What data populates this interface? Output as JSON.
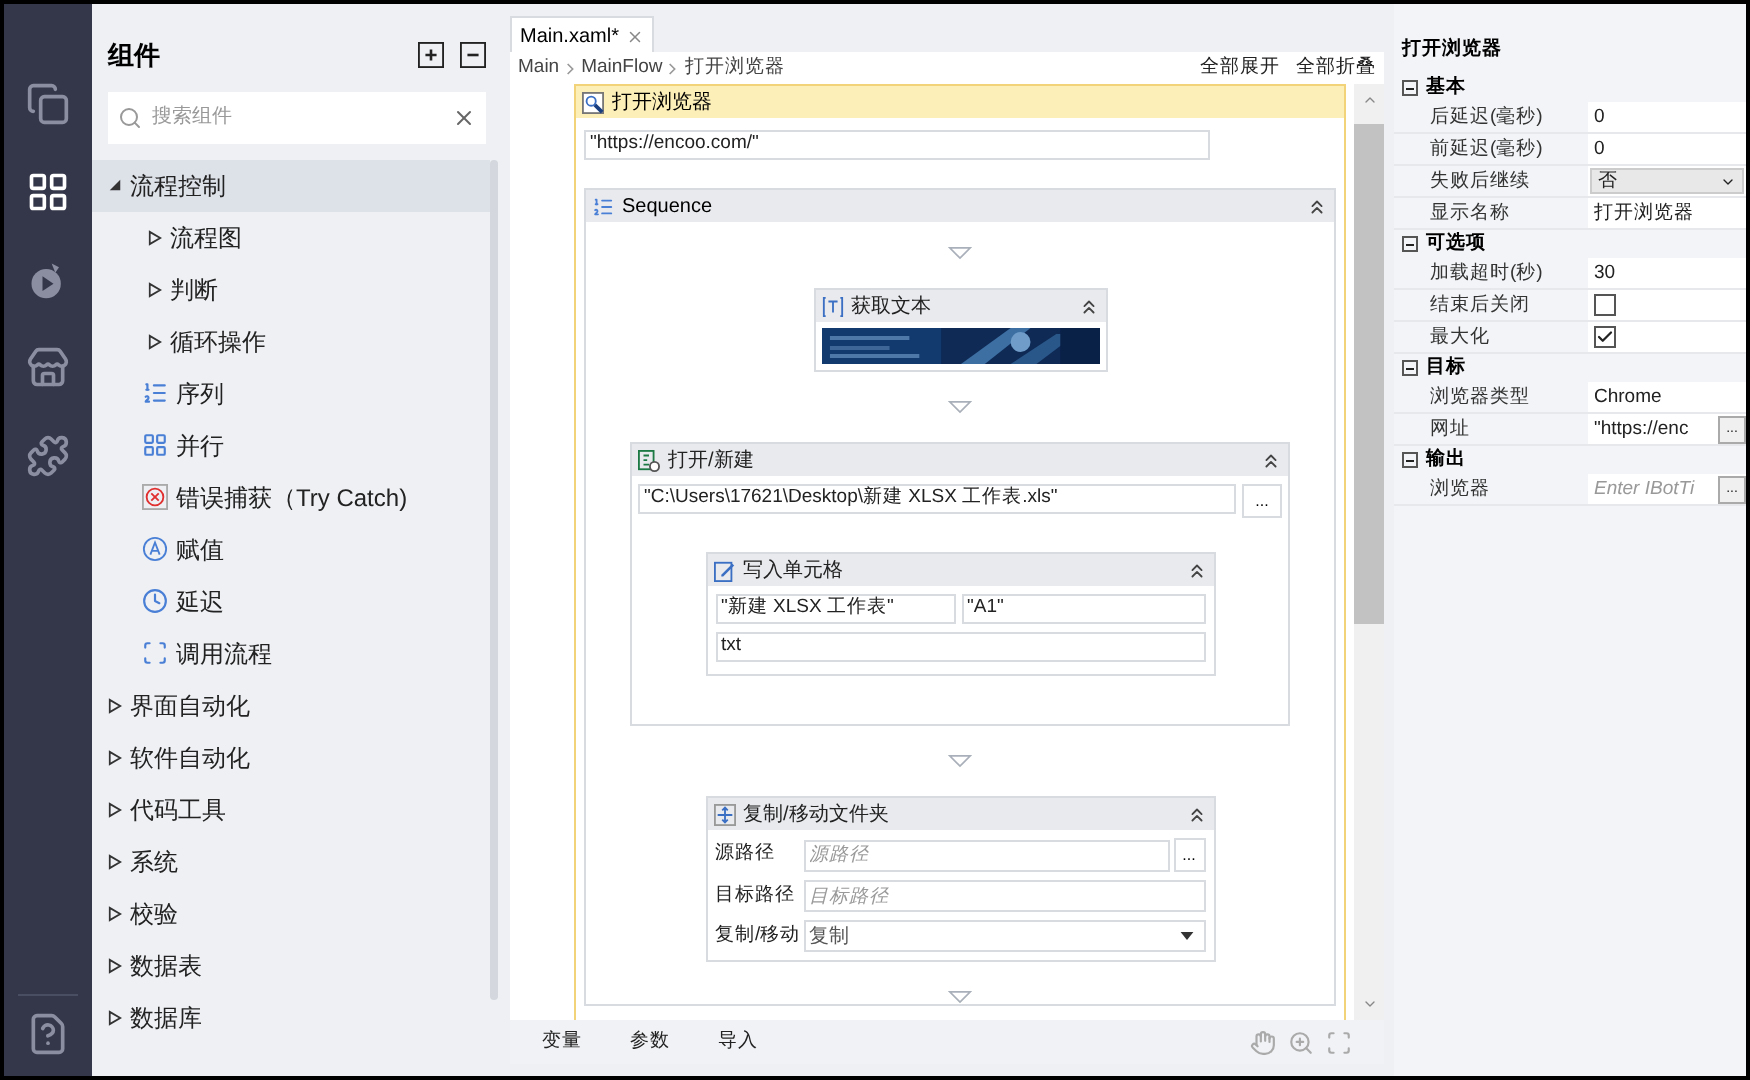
{
  "rail": [
    {
      "kind": "pages",
      "selected": false
    },
    {
      "kind": "components",
      "selected": true
    },
    {
      "kind": "recorder",
      "selected": false
    },
    {
      "kind": "store",
      "selected": false
    },
    {
      "kind": "plugins",
      "selected": false
    }
  ],
  "rail_bottom": {
    "kind": "help"
  },
  "components": {
    "title": "组件",
    "search": {
      "placeholder": "搜索组件"
    },
    "tree": [
      {
        "label": "流程控制",
        "expanded": true,
        "selected": true,
        "children": [
          {
            "kind": "folder",
            "label": "流程图",
            "expanded": false,
            "selected": false
          },
          {
            "kind": "folder",
            "label": "判断",
            "expanded": false,
            "selected": false
          },
          {
            "kind": "folder",
            "label": "循环操作",
            "expanded": false,
            "selected": false
          },
          {
            "kind": "sequence",
            "label": "序列",
            "selected": false
          },
          {
            "kind": "parallel",
            "label": "并行",
            "selected": false
          },
          {
            "kind": "trycatch",
            "label": "错误捕获（Try Catch)",
            "selected": false
          },
          {
            "kind": "assign",
            "label": "赋值",
            "selected": false
          },
          {
            "kind": "delay",
            "label": "延迟",
            "selected": false
          },
          {
            "kind": "invoke",
            "label": "调用流程",
            "selected": false
          }
        ]
      },
      {
        "label": "界面自动化",
        "expanded": false,
        "selected": false
      },
      {
        "label": "软件自动化",
        "expanded": false,
        "selected": false
      },
      {
        "label": "代码工具",
        "expanded": false,
        "selected": false
      },
      {
        "label": "系统",
        "expanded": false,
        "selected": false
      },
      {
        "label": "校验",
        "expanded": false,
        "selected": false
      },
      {
        "label": "数据表",
        "expanded": false,
        "selected": false
      },
      {
        "label": "数据库",
        "expanded": false,
        "selected": false
      }
    ]
  },
  "editor": {
    "tabs": [
      {
        "label": "Main.xaml*",
        "selected": true
      }
    ],
    "breadcrumb": [
      "Main",
      "MainFlow",
      "打开浏览器"
    ],
    "actions": [
      "全部展开",
      "全部折叠"
    ],
    "activity": {
      "title": "打开浏览器",
      "url": "\"https://encoo.com/\"",
      "sequence": {
        "title": "Sequence",
        "steps": [
          {
            "kind": "get_text",
            "title": "获取文本"
          },
          {
            "kind": "excel",
            "title": "打开/新建",
            "path": "\"C:\\Users\\17621\\Desktop\\新建 XLSX 工作表.xls\"",
            "browse": "...",
            "inner": {
              "title": "写入单元格",
              "sheet": "\"新建 XLSX 工作表\"",
              "cell": "\"A1\"",
              "value": "txt"
            }
          },
          {
            "kind": "copy_folder",
            "title": "复制/移动文件夹",
            "fields": [
              {
                "kind": "browse",
                "label": "源路径",
                "placeholder": "源路径",
                "button": "..."
              },
              {
                "kind": "text",
                "label": "目标路径",
                "placeholder": "目标路径"
              },
              {
                "kind": "select",
                "label": "复制/移动",
                "value": "复制"
              }
            ]
          }
        ]
      }
    },
    "bottom_tabs": [
      "变量",
      "参数",
      "导入"
    ]
  },
  "properties": {
    "title": "打开浏览器",
    "groups": [
      {
        "label": "基本",
        "expanded": true,
        "rows": [
          {
            "kind": "text",
            "label": "后延迟(毫秒)",
            "value": "0"
          },
          {
            "kind": "text",
            "label": "前延迟(毫秒)",
            "value": "0"
          },
          {
            "kind": "select",
            "label": "失败后继续",
            "value": "否"
          },
          {
            "kind": "text",
            "label": "显示名称",
            "value": "打开浏览器"
          }
        ]
      },
      {
        "label": "可选项",
        "expanded": true,
        "rows": [
          {
            "kind": "text",
            "label": "加载超时(秒)",
            "value": "30"
          },
          {
            "kind": "checkbox",
            "label": "结束后关闭",
            "checked": false
          },
          {
            "kind": "checkbox",
            "label": "最大化",
            "checked": true
          }
        ]
      },
      {
        "label": "目标",
        "expanded": true,
        "rows": [
          {
            "kind": "text",
            "label": "浏览器类型",
            "value": "Chrome"
          },
          {
            "kind": "browse",
            "label": "网址",
            "value": "\"https://enc",
            "button": "..."
          }
        ]
      },
      {
        "label": "输出",
        "expanded": true,
        "rows": [
          {
            "kind": "browse",
            "label": "浏览器",
            "placeholder": "Enter IBotTi",
            "button": "..."
          }
        ]
      }
    ]
  }
}
